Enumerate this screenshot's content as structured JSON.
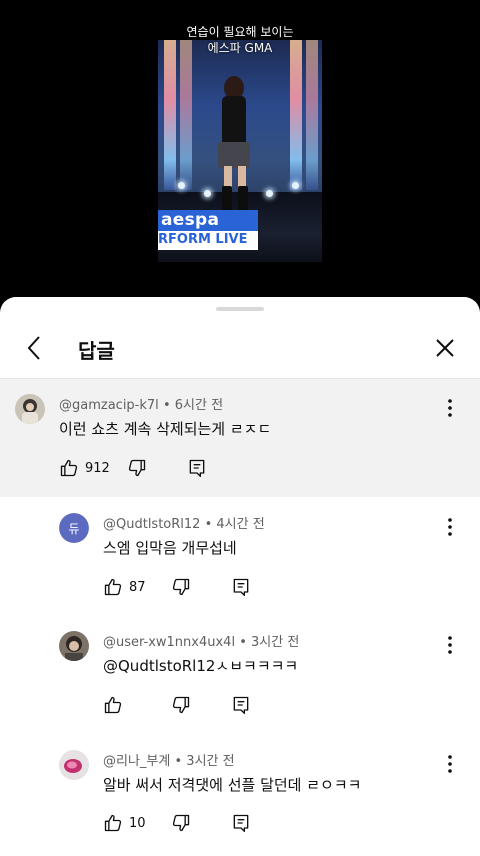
{
  "video": {
    "caption_line1": "연습이 필요해 보이는",
    "caption_line2": "에스파 GMA",
    "logo_line1": "aespa",
    "logo_line2": "RFORM LIVE"
  },
  "panel": {
    "title": "답글"
  },
  "parent_comment": {
    "author": "@gamzacip-k7l",
    "time": "6시간 전",
    "text": "이런 쇼츠 계속 삭제되는게 ㄹㅈㄷ",
    "likes": "912"
  },
  "replies": [
    {
      "author": "@QudtlstoRl12",
      "time": "4시간 전",
      "text": "스엠 입막음 개무섭네",
      "likes": "87",
      "avatar_letter": "듀",
      "avatar_color": "#5c6bc0"
    },
    {
      "author": "@user-xw1nnx4ux4l",
      "time": "3시간 전",
      "text": "@QudtlstoRl12ㅅㅂㅋㅋㅋㅋ",
      "likes": ""
    },
    {
      "author": "@리나_부계",
      "time": "3시간 전",
      "text": "알바 써서 저격댓에 선플 달던데 ㄹㅇㅋㅋ",
      "likes": "10"
    }
  ],
  "meta_separator": "•"
}
